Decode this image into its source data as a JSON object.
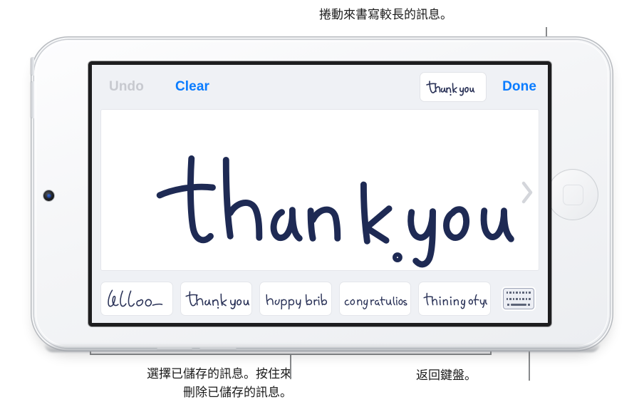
{
  "annotations": {
    "top": "捲動來書寫較長的訊息。",
    "bottom_left": "選擇已儲存的訊息。按住來\n刪除已儲存的訊息。",
    "bottom_right": "返回鍵盤。"
  },
  "screen": {
    "toolbar": {
      "undo_label": "Undo",
      "clear_label": "Clear",
      "done_label": "Done",
      "saved_thumb_text": "thank you",
      "saved_thumb_icon": "handwriting-thumbnail-icon"
    },
    "canvas": {
      "ink_text": "thank you",
      "scroll_icon": "chevron-right-icon"
    },
    "saved_messages": [
      {
        "text": "hello"
      },
      {
        "text": "thank you"
      },
      {
        "text": "happy birthday"
      },
      {
        "text": "congratulations"
      },
      {
        "text": "thinking of you"
      }
    ],
    "keyboard_button": {
      "icon": "keyboard-icon"
    }
  },
  "device": {
    "home_button_icon": "home-rounded-square-icon",
    "camera_icon": "front-camera-icon"
  },
  "colors": {
    "accent_blue": "#0a7cff",
    "disabled_gray": "#c7c9cf",
    "ink_navy": "#1e2a54",
    "screen_bg": "#eff1f5",
    "callout_gray": "#888a8c"
  }
}
